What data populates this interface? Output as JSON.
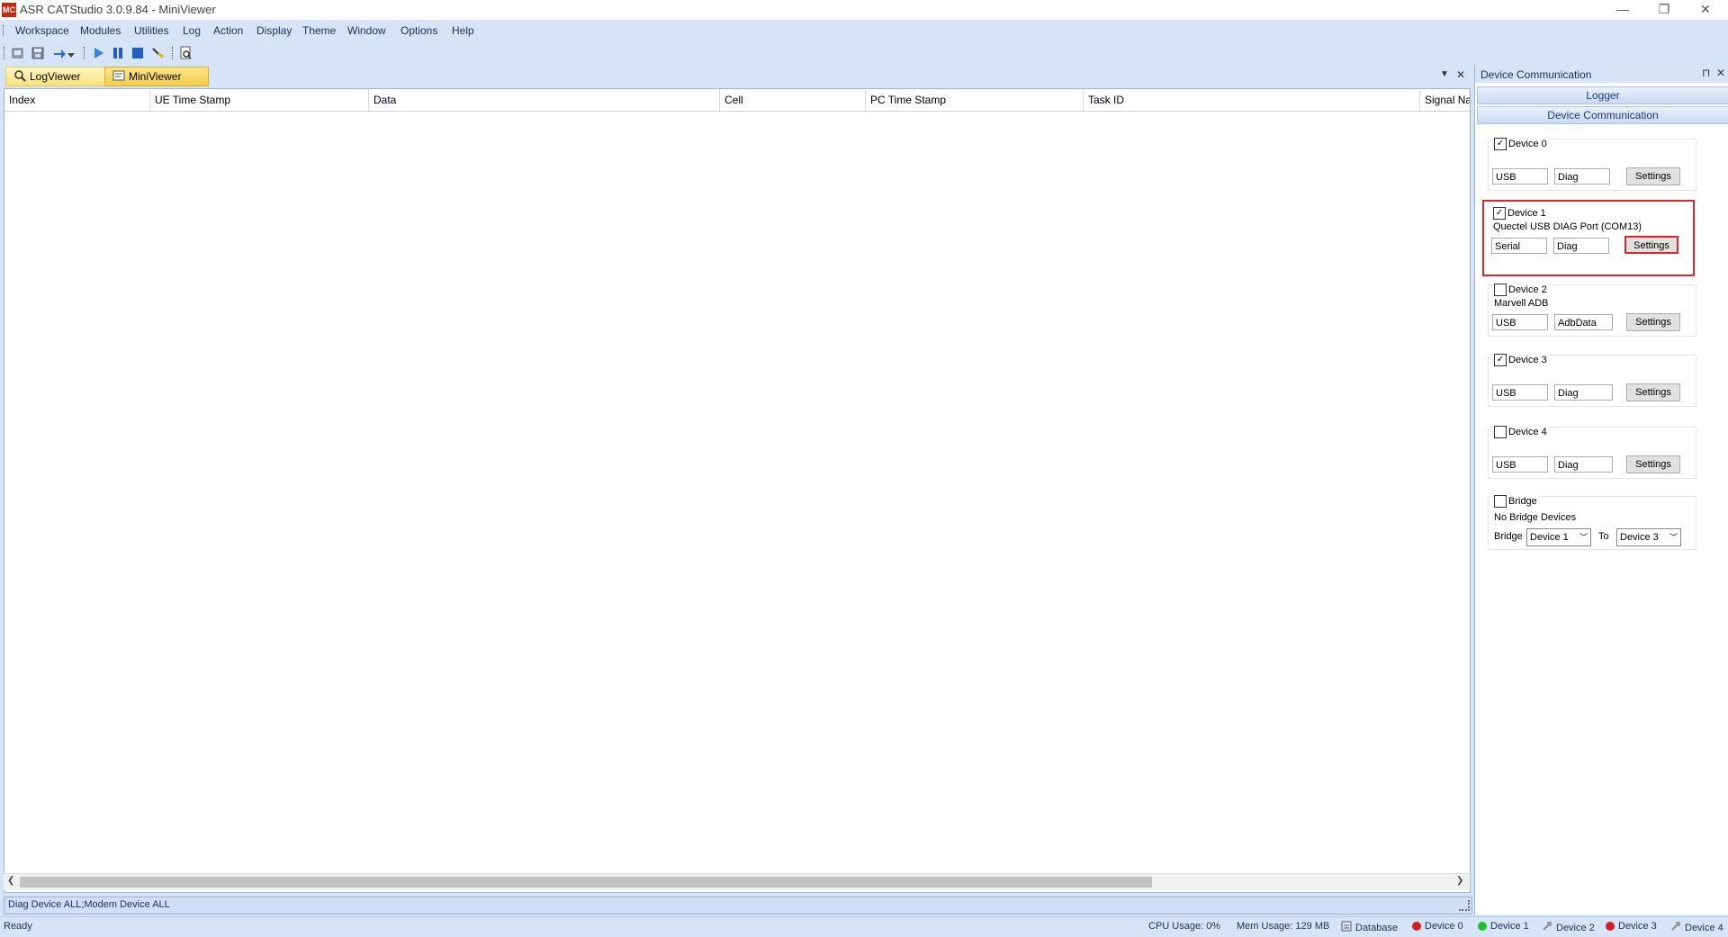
{
  "window": {
    "title": "ASR CATStudio 3.0.9.84 - MiniViewer",
    "icon_label": "MC",
    "controls": [
      "—",
      "❐",
      "✕"
    ]
  },
  "menu": [
    "Workspace",
    "Modules",
    "Utilities",
    "Log",
    "Action",
    "Display",
    "Theme",
    "Window",
    "Options",
    "Help"
  ],
  "tabs": [
    {
      "label": "LogViewer"
    },
    {
      "label": "MiniViewer"
    }
  ],
  "grid": {
    "columns": [
      "Index",
      "UE Time Stamp",
      "Data",
      "Cell",
      "PC Time Stamp",
      "Task ID",
      "Signal Na"
    ]
  },
  "filter_bar": "Diag Device ALL;Modem Device ALL",
  "status": {
    "ready": "Ready",
    "cpu": "CPU Usage:  0%",
    "mem": "Mem Usage: 129 MB",
    "database": "Database",
    "devices": [
      {
        "label": "Device 0",
        "color": "#d11f1f"
      },
      {
        "label": "Device 1",
        "color": "#1fbf2a"
      },
      {
        "label": "Device 2",
        "color": "#9a9a9a"
      },
      {
        "label": "Device 3",
        "color": "#d11f1f"
      },
      {
        "label": "Device 4",
        "color": "#9a9a9a"
      }
    ]
  },
  "panel": {
    "title": "Device Communication",
    "pin": "⊓",
    "close": "✕",
    "logger_header": "Logger",
    "devcomm_header": "Device Communication",
    "devices": [
      {
        "label": "Device 0",
        "checked": "✓",
        "desc": "",
        "port": "USB",
        "mode": "Diag",
        "button": "Settings"
      },
      {
        "label": "Device 1",
        "checked": "✓",
        "desc": "Quectel USB DIAG Port (COM13)",
        "port": "Serial",
        "mode": "Diag",
        "button": "Settings"
      },
      {
        "label": "Device 2",
        "checked": "",
        "desc": "Marvell ADB",
        "port": "USB",
        "mode": "AdbData",
        "button": "Settings"
      },
      {
        "label": "Device 3",
        "checked": "✓",
        "desc": "",
        "port": "USB",
        "mode": "Diag",
        "button": "Settings"
      },
      {
        "label": "Device 4",
        "checked": "",
        "desc": "",
        "port": "USB",
        "mode": "Diag",
        "button": "Settings"
      }
    ],
    "bridge": {
      "label": "Bridge",
      "checked": "",
      "desc": "No Bridge Devices",
      "from_label": "Bridge",
      "from_value": "Device 1",
      "to_label": "To",
      "to_value": "Device 3"
    }
  },
  "tab_controls": {
    "dropdown": "▼",
    "close": "✕"
  }
}
